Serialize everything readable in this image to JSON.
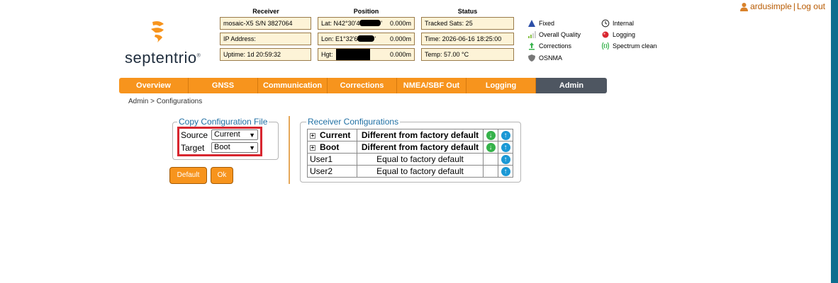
{
  "user": {
    "name": "ardusimple",
    "separator": "|",
    "logout": "Log out"
  },
  "logo": {
    "text": "septentrio"
  },
  "status": {
    "receiver_header": "Receiver",
    "position_header": "Position",
    "status_header": "Status",
    "receiver": [
      "mosaic-X5 S/N 3827064",
      "IP Address:",
      "Uptime: 1d 20:59:32"
    ],
    "position": [
      {
        "label": "Lat:  N42°30'4",
        "value": "0.000m"
      },
      {
        "label": "Lon: E1°32'6",
        "value": "0.000m"
      },
      {
        "label": "Hgt:",
        "value": "0.000m"
      }
    ],
    "status": [
      "Tracked Sats: 25",
      "Time: 2026-06-16 18:25:00",
      "Temp: 57.00 °C"
    ]
  },
  "legend": {
    "left": [
      "Fixed",
      "Overall Quality",
      "Corrections",
      "OSNMA"
    ],
    "right": [
      "Internal",
      "Logging",
      "Spectrum clean"
    ]
  },
  "nav": {
    "tabs": [
      "Overview",
      "GNSS",
      "Communication",
      "Corrections",
      "NMEA/SBF Out",
      "Logging",
      "Admin"
    ],
    "active": "Admin"
  },
  "breadcrumb": "Admin > Configurations",
  "copy": {
    "legend": "Copy Configuration File",
    "source_label": "Source",
    "source_value": "Current",
    "target_label": "Target",
    "target_value": "Boot",
    "default_button": "Default",
    "ok_button": "Ok"
  },
  "receiver_configs": {
    "legend": "Receiver Configurations",
    "rows": [
      {
        "name": "Current",
        "status": "Different from factory default"
      },
      {
        "name": "Boot",
        "status": "Different from factory default"
      },
      {
        "name": "User1",
        "status": "Equal to factory default"
      },
      {
        "name": "User2",
        "status": "Equal to factory default"
      }
    ]
  },
  "colors": {
    "accent": "#f7941d",
    "active_tab": "#4e5661",
    "highlight": "#d8262f"
  }
}
